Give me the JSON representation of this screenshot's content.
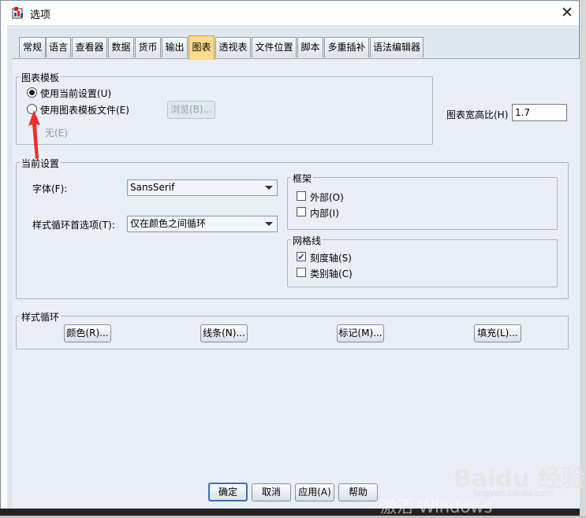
{
  "window": {
    "title": "选项",
    "close_glyph": "✕"
  },
  "tabs": [
    {
      "label": "常规"
    },
    {
      "label": "语言"
    },
    {
      "label": "查看器"
    },
    {
      "label": "数据"
    },
    {
      "label": "货币"
    },
    {
      "label": "输出"
    },
    {
      "label": "图表",
      "active": true
    },
    {
      "label": "透视表"
    },
    {
      "label": "文件位置"
    },
    {
      "label": "脚本"
    },
    {
      "label": "多重插补"
    },
    {
      "label": "语法编辑器"
    }
  ],
  "chart_template": {
    "legend": "图表模板",
    "use_current": "使用当前设置(U)",
    "use_template_file": "使用图表模板文件(E)",
    "browse_button": "浏览(B)...",
    "file_value": "无(E)",
    "selected": "use_current"
  },
  "aspect_ratio": {
    "label": "图表宽高比(H)",
    "value": "1.7"
  },
  "current_settings": {
    "legend": "当前设置",
    "font_label": "字体(F):",
    "font_value": "SansSerif",
    "cycle_label": "样式循环首选项(T):",
    "cycle_value": "仅在颜色之间循环"
  },
  "frame": {
    "legend": "框架",
    "outer": "外部(O)",
    "outer_checked": false,
    "inner": "内部(I)",
    "inner_checked": false
  },
  "gridlines": {
    "legend": "网格线",
    "scale_axis": "刻度轴(S)",
    "scale_checked": true,
    "category_axis": "类别轴(C)",
    "category_checked": false
  },
  "style_cycles": {
    "legend": "样式循环",
    "colors": "颜色(R)...",
    "lines": "线条(N)...",
    "markers": "标记(M)...",
    "fills": "填充(L)..."
  },
  "footer": {
    "ok": "确定",
    "cancel": "取消",
    "apply": "应用(A)",
    "help": "帮助"
  },
  "watermarks": {
    "windows": "激活 Windows",
    "baidu": "Baidu 经验",
    "url": "jingyan.baidu.com"
  },
  "colors": {
    "active_tab": "#fcdc8c",
    "annotation_arrow": "#e8312a",
    "panel_bg": "#e9eff6"
  }
}
